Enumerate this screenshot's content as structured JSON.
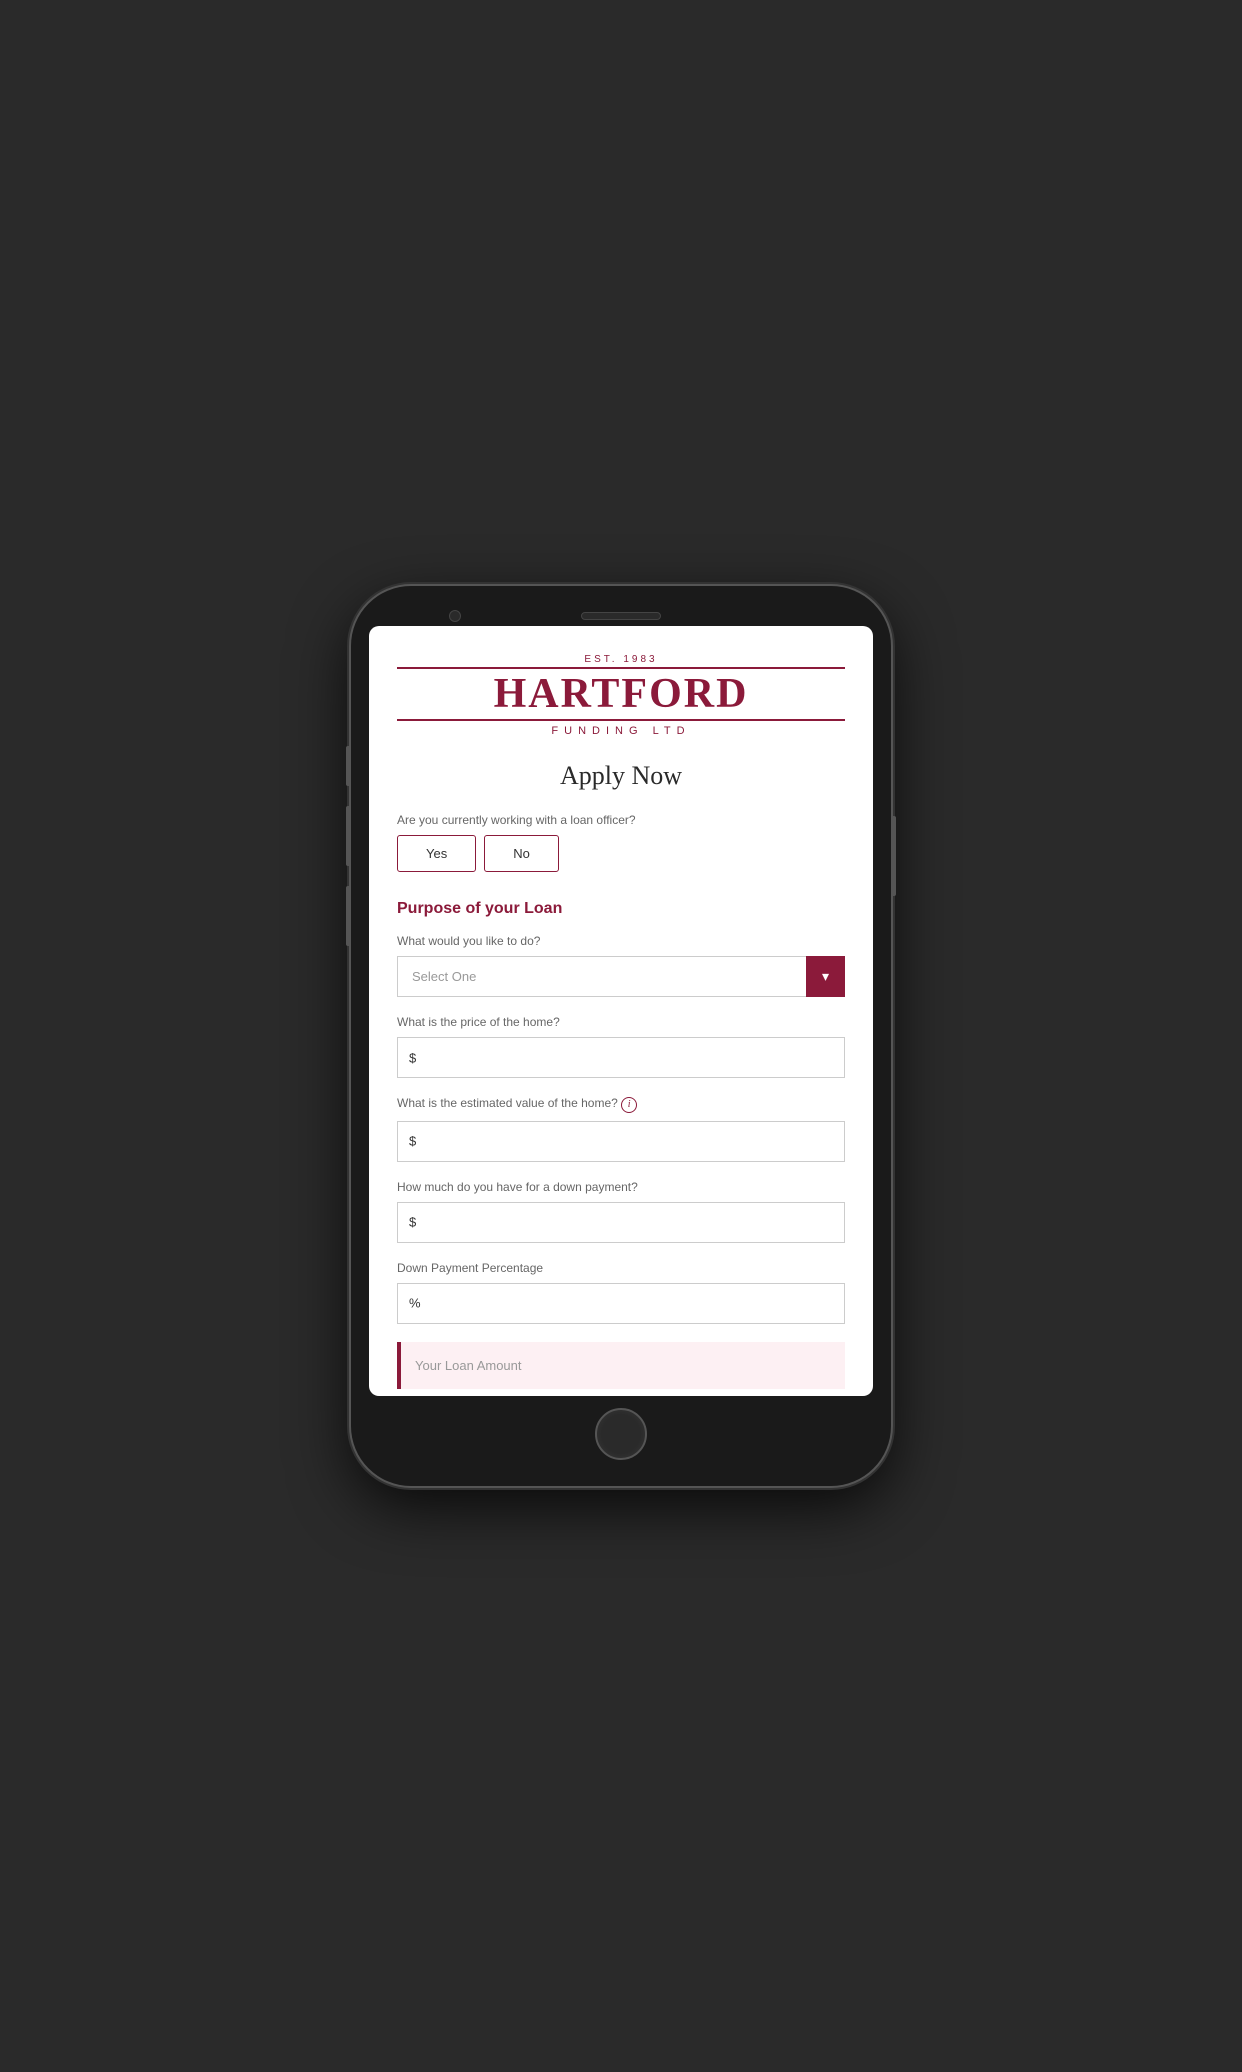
{
  "phone": {
    "background": "#1a1a1a"
  },
  "logo": {
    "est": "EST. 1983",
    "name": "HARTFORD",
    "sub": "FUNDING LTD"
  },
  "page": {
    "title": "Apply Now",
    "loan_officer_question": "Are you currently working with a loan officer?",
    "yes_label": "Yes",
    "no_label": "No",
    "section_title": "Purpose of your Loan",
    "what_to_do_label": "What would you like to do?",
    "select_placeholder": "Select One",
    "home_price_label": "What is the price of the home?",
    "home_price_prefix": "$",
    "estimated_value_label": "What is the estimated value of the home?",
    "estimated_value_prefix": "$",
    "down_payment_label": "How much do you have for a down payment?",
    "down_payment_prefix": "$",
    "down_payment_pct_label": "Down Payment Percentage",
    "down_payment_pct_prefix": "%",
    "loan_amount_label": "Your Loan Amount"
  },
  "colors": {
    "brand": "#8b1a3a",
    "text_dark": "#2a2a2a",
    "text_muted": "#666666",
    "bg_loan": "#fdf0f3"
  }
}
